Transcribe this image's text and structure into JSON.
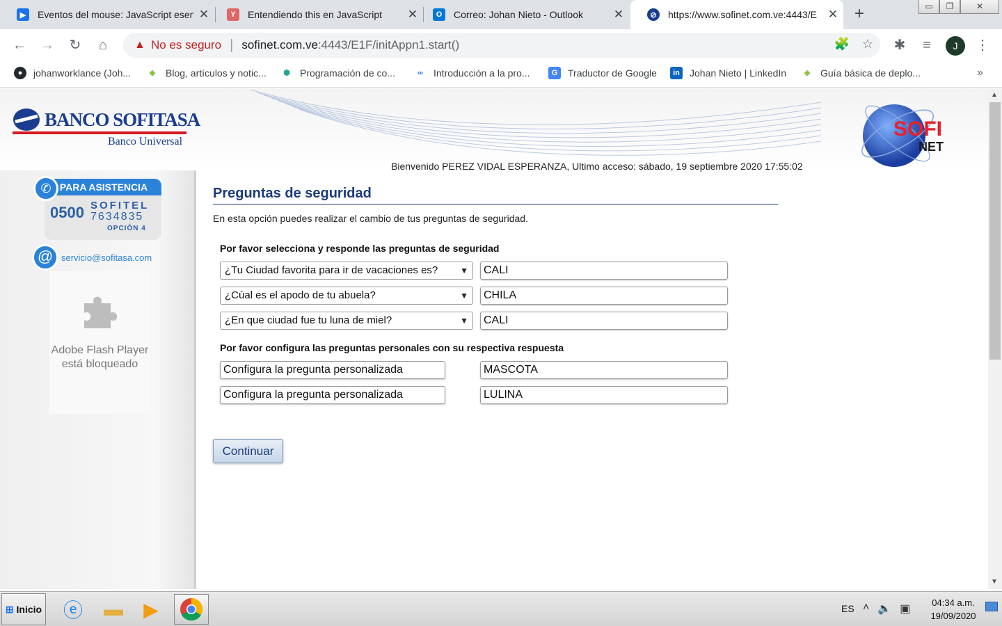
{
  "browser": {
    "tabs": [
      {
        "title": "Eventos del mouse: JavaScript esen",
        "icon": "video-icon",
        "color": "#1a73e8"
      },
      {
        "title": "Entendiendo this en JavaScript",
        "icon": "y-icon",
        "color": "#e06666",
        "icon_text": "Y"
      },
      {
        "title": "Correo: Johan Nieto - Outlook",
        "icon": "outlook-icon",
        "color": "#0078d4",
        "icon_text": "O"
      },
      {
        "title": "https://www.sofinet.com.ve:4443/E",
        "icon": "sofinet-icon",
        "color": "#1a3d8f"
      }
    ],
    "address": {
      "warning": "No es seguro",
      "host": "sofinet.com.ve",
      "rest": ":4443/E1F/initAppn1.start()"
    },
    "profile_initial": "J",
    "bookmarks": [
      {
        "label": "johanworklance (Joh...",
        "icon": "github-icon"
      },
      {
        "label": "Blog, artículos y notic...",
        "icon": "diamond-icon"
      },
      {
        "label": "Programación de co...",
        "icon": "shield-icon"
      },
      {
        "label": "Introducción a la pro...",
        "icon": "infinity-icon"
      },
      {
        "label": "Traductor de Google",
        "icon": "translate-icon"
      },
      {
        "label": "Johan Nieto | LinkedIn",
        "icon": "linkedin-icon",
        "icon_text": "in"
      },
      {
        "label": "Guía básica de deplo...",
        "icon": "diamond-icon"
      }
    ]
  },
  "site": {
    "bank_name": "BANCO SOFITASA",
    "bank_sub": "Banco Universal",
    "sofi_logo": {
      "top": "SOFI",
      "bottom": "NET"
    },
    "welcome": "Bienvenido PEREZ VIDAL ESPERANZA, Ultimo acceso: sábado, 19 septiembre 2020  17:55:02",
    "assist": {
      "label": "PARA ASISTENCIA",
      "prefix": "0500",
      "brand": "SOFITEL",
      "digits": "7634835",
      "option": "OPCIÓN 4"
    },
    "email": "servicio@sofitasa.com",
    "flash_text": "Adobe Flash Player está bloqueado"
  },
  "form": {
    "title": "Preguntas de seguridad",
    "description": "En esta opción puedes realizar el cambio de tus preguntas de seguridad.",
    "section1": "Por favor selecciona y responde las preguntas de seguridad",
    "questions": [
      {
        "question": "¿Tu Ciudad favorita para ir de vacaciones es?",
        "answer": "CALI"
      },
      {
        "question": "¿Cúal es el apodo de tu abuela?",
        "answer": "CHILA"
      },
      {
        "question": "¿En que ciudad fue tu luna de miel?",
        "answer": "CALI"
      }
    ],
    "section2": "Por favor configura las preguntas personales con su respectiva respuesta",
    "custom": [
      {
        "question": "Configura la pregunta personalizada",
        "answer": "MASCOTA"
      },
      {
        "question": "Configura la pregunta personalizada",
        "answer": "LULINA"
      }
    ],
    "submit": "Continuar"
  },
  "taskbar": {
    "start": "Inicio",
    "lang": "ES",
    "time": "04:34 a.m.",
    "date": "19/09/2020"
  }
}
